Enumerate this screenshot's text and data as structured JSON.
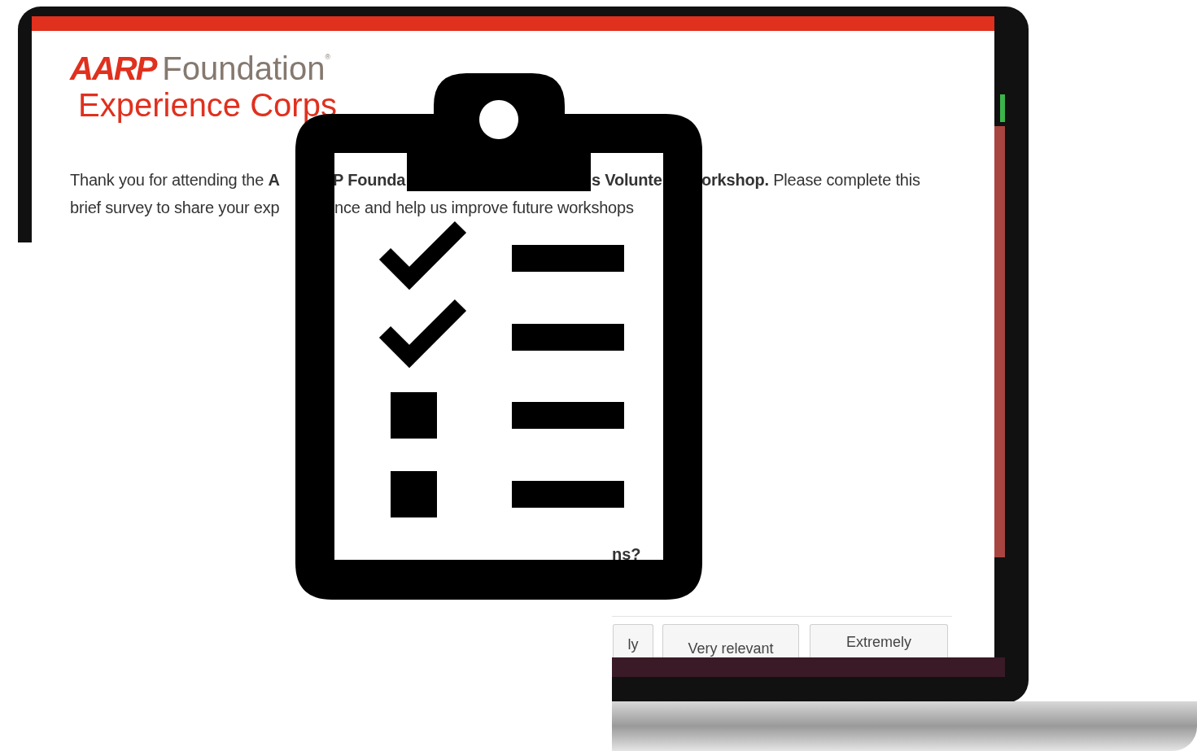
{
  "logo": {
    "brand": "AARP",
    "name": "Foundation",
    "mark": "®",
    "subtitle": "Experience Corps"
  },
  "intro_fragments": [
    {
      "text": "Thank you for attending the **A**"
    },
    {
      "text": "**P Founda**"
    },
    {
      "text": "**s Volunte**"
    },
    {
      "text": "**orkshop.** Please complete this"
    },
    {
      "text": "brief survey to share your exp"
    },
    {
      "text": "nce and help us improve future workshops"
    }
  ],
  "question_fragment": "ns?",
  "answer_options": [
    {
      "label": "ly"
    },
    {
      "label": "Very relevant"
    },
    {
      "label": "Extremely"
    }
  ]
}
